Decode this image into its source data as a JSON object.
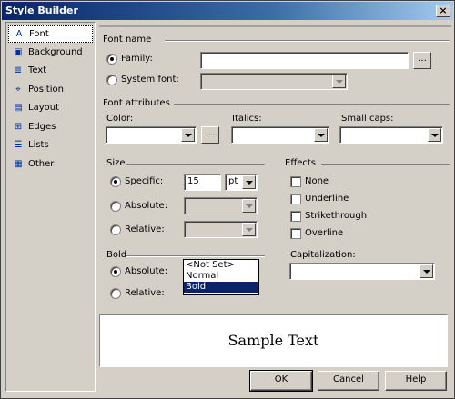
{
  "window": {
    "title": "Style Builder",
    "close_glyph": "×"
  },
  "sidebar": {
    "items": [
      {
        "label": "Font",
        "icon": "font-icon",
        "glyph": "A"
      },
      {
        "label": "Background",
        "icon": "background-icon",
        "glyph": "▣"
      },
      {
        "label": "Text",
        "icon": "text-icon",
        "glyph": "≣"
      },
      {
        "label": "Position",
        "icon": "position-icon",
        "glyph": "⌖"
      },
      {
        "label": "Layout",
        "icon": "layout-icon",
        "glyph": "▤"
      },
      {
        "label": "Edges",
        "icon": "edges-icon",
        "glyph": "⊞"
      },
      {
        "label": "Lists",
        "icon": "lists-icon",
        "glyph": "☰"
      },
      {
        "label": "Other",
        "icon": "other-icon",
        "glyph": "▦"
      }
    ],
    "selected": "Font"
  },
  "font_name": {
    "section": "Font name",
    "family_label": "Family:",
    "family_value": "",
    "system_font_label": "System font:",
    "system_font_value": ""
  },
  "font_attributes": {
    "section": "Font attributes",
    "color_label": "Color:",
    "italics_label": "Italics:",
    "small_caps_label": "Small caps:"
  },
  "size": {
    "section": "Size",
    "specific_label": "Specific:",
    "specific_value": "15",
    "unit_value": "pt",
    "absolute_label": "Absolute:",
    "relative_label": "Relative:"
  },
  "effects": {
    "section": "Effects",
    "options": [
      "None",
      "Underline",
      "Strikethrough",
      "Overline"
    ]
  },
  "bold": {
    "section": "Bold",
    "absolute_label": "Absolute:",
    "relative_label": "Relative:",
    "dropdown_options": [
      "<Not Set>",
      "Normal",
      "Bold"
    ],
    "highlighted": "Bold"
  },
  "capitalization": {
    "label": "Capitalization:",
    "value": ""
  },
  "preview": {
    "text": "Sample Text"
  },
  "buttons": {
    "ok": "OK",
    "cancel": "Cancel",
    "help": "Help"
  },
  "ellipsis": "..."
}
